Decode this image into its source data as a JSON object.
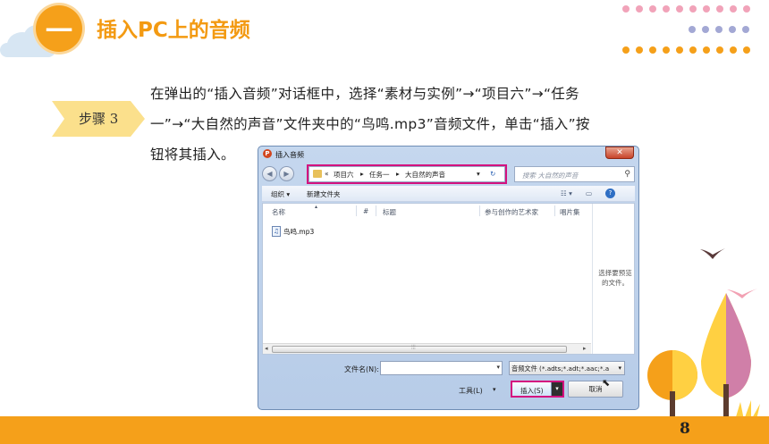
{
  "header": {
    "number": "一",
    "title": "插入PC上的音频"
  },
  "step": {
    "label": "步骤 3"
  },
  "instruction": {
    "line1": "在弹出的“插入音频”对话框中，选择“素材与实例”→“项目六”→“任务",
    "line2": "一”→“大自然的声音”文件夹中的“鸟鸣.mp3”音频文件，单击“插入”按",
    "line3": "钮将其插入。"
  },
  "dialog": {
    "title": "插入音频",
    "close_glyph": "✕",
    "address": {
      "lead": "«",
      "parts": [
        "项目六",
        "任务一",
        "大自然的声音"
      ],
      "sep": "▸",
      "refresh": "↻"
    },
    "search_placeholder": "搜索 大自然的声音",
    "toolbar": {
      "organize": "组织 ▾",
      "new_folder": "新建文件夹"
    },
    "columns": [
      "名称",
      "#",
      "标题",
      "参与创作的艺术家",
      "唱片集"
    ],
    "files": [
      {
        "name": "鸟鸣.mp3"
      }
    ],
    "preview_text": "选择要预览的文件。",
    "filename_label": "文件名(N):",
    "filename_value": "",
    "file_type": "音频文件 (*.adts;*.adt;*.aac;*.a",
    "tools_label": "工具(L)",
    "insert_label": "插入(S)",
    "cancel_label": "取消"
  },
  "colors": {
    "accent": "#f5a01a",
    "highlight": "#d4127f"
  },
  "page_number": "8"
}
